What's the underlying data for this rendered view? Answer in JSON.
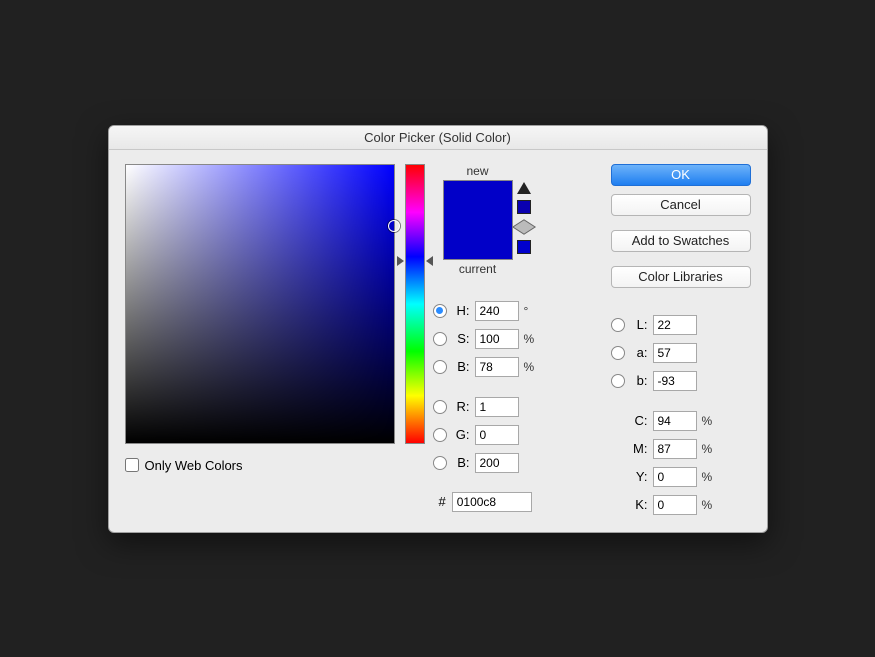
{
  "title": "Color Picker (Solid Color)",
  "buttons": {
    "ok": "OK",
    "cancel": "Cancel",
    "add_swatches": "Add to Swatches",
    "color_libraries": "Color Libraries"
  },
  "swatch": {
    "new_label": "new",
    "current_label": "current",
    "new_color": "#0100c8",
    "current_color": "#0100c8"
  },
  "web_only_label": "Only Web Colors",
  "hsb": {
    "h_label": "H:",
    "h_value": "240",
    "h_unit": "°",
    "s_label": "S:",
    "s_value": "100",
    "s_unit": "%",
    "b_label": "B:",
    "b_value": "78",
    "b_unit": "%"
  },
  "rgb": {
    "r_label": "R:",
    "r_value": "1",
    "g_label": "G:",
    "g_value": "0",
    "b_label": "B:",
    "b_value": "200"
  },
  "lab": {
    "l_label": "L:",
    "l_value": "22",
    "a_label": "a:",
    "a_value": "57",
    "b_label": "b:",
    "b_value": "-93"
  },
  "cmyk": {
    "c_label": "C:",
    "c_value": "94",
    "m_label": "M:",
    "m_value": "87",
    "y_label": "Y:",
    "y_value": "0",
    "k_label": "K:",
    "k_value": "0",
    "unit": "%"
  },
  "hex": {
    "hash": "#",
    "value": "0100c8"
  }
}
